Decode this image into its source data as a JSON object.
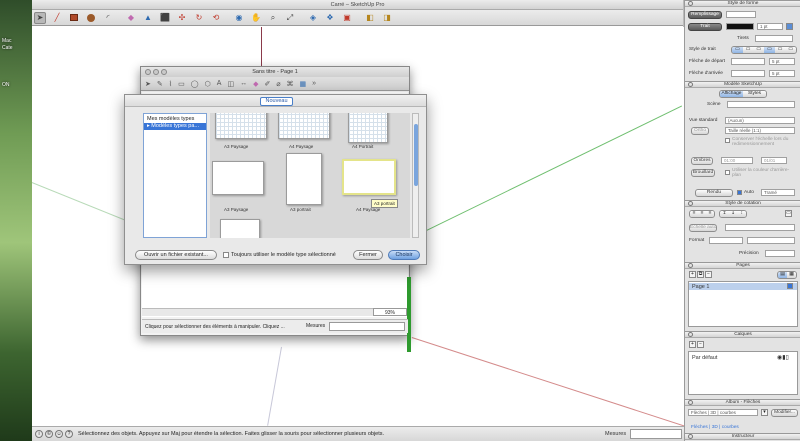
{
  "window": {
    "title": "Carré – SketchUp Pro"
  },
  "desktop": {
    "labels": [
      "Mac",
      "Cate",
      "ON"
    ]
  },
  "main_toolbar": {
    "tools": [
      "select-arrow",
      "line-pencil",
      "rectangle",
      "circle",
      "arc",
      "eraser",
      "paint-bucket",
      "push-pull",
      "move",
      "rotate",
      "follow-me",
      "orbit",
      "pan",
      "zoom",
      "zoom-extents",
      "3d-warehouse",
      "components",
      "layout",
      "style-builder"
    ]
  },
  "statusbar": {
    "text": "Sélectionnez des objets. Appuyez sur Maj pour étendre la sélection. Faites glisser la souris pour sélectionner plusieurs objets.",
    "measure_label": "Mesures"
  },
  "layout_window": {
    "title": "Sans titre - Page 1",
    "zoom": "93%",
    "status_text": "Cliquez pour sélectionner des éléments à manipuler. Cliquez ...",
    "measure_label": "Mesures"
  },
  "template_sheet": {
    "tab": "Nouveau",
    "categories": [
      "Mes modèles types",
      "▸ Modèles types pa..."
    ],
    "thumbnails": [
      {
        "caption": "A3 Paysage"
      },
      {
        "caption": "A4 Paysage"
      },
      {
        "caption": "A4 Portrait"
      },
      {
        "caption": "A3 Paysage"
      },
      {
        "caption": "A3 portrait"
      },
      {
        "caption": "A4 Paysage"
      }
    ],
    "tooltip": "A3 portrait",
    "buttons": {
      "open_existing": "Ouvrir un fichier existant...",
      "always_use": "Toujours utiliser le modèle type sélectionné",
      "close": "Fermer",
      "choose": "Choisir"
    }
  },
  "right_panel": {
    "shape_style": {
      "title": "Style de forme",
      "fill": "Remplissage",
      "stroke": "Trait",
      "stroke_width": "1 pt",
      "dashes": "Tirets",
      "stroke_style": "Style de trait",
      "start_arrow": "Flèche de départ",
      "start_size": "5 pt",
      "end_arrow": "Flèche d'arrivée",
      "end_size": "5 pt"
    },
    "sketchup_model": {
      "title": "Modèle SketchUp",
      "tabs": [
        "Affichage",
        "Styles"
      ],
      "scene_label": "Scène",
      "std_view_label": "Vue standard",
      "std_view_value": "(Aucun)",
      "ortho": "Ortho",
      "scale_value": "Taille réelle (1:1)",
      "keep_scale": "Conserver l'échelle lors du redimensionnement",
      "shadows": "Ombres",
      "time1": "01:00",
      "time2": "01/01",
      "fog": "Brouillard",
      "bg_color": "Utiliser la couleur d'arrière-plan",
      "render": "Rendu",
      "auto": "Auto",
      "render_mode": "Tramé"
    },
    "text_style": {
      "title": "Style de cotation",
      "auto_scale": "Échelle auto",
      "format": "Format",
      "precision": "Précision"
    },
    "pages": {
      "title": "Pages",
      "items": [
        "Page 1"
      ]
    },
    "layers": {
      "title": "Calques",
      "items": [
        "Par défaut"
      ]
    },
    "album": {
      "title": "Album - Flèches",
      "select_value": "Flèches | 3D | courbes",
      "modify": "Modifier...",
      "footer": "Flèches | 3D | courbes"
    },
    "instructor": {
      "title": "Instructeur"
    }
  },
  "colors": {
    "accent": "#3875d7",
    "green_axis": "#2e9a2e",
    "red_axis": "#c0392b"
  }
}
